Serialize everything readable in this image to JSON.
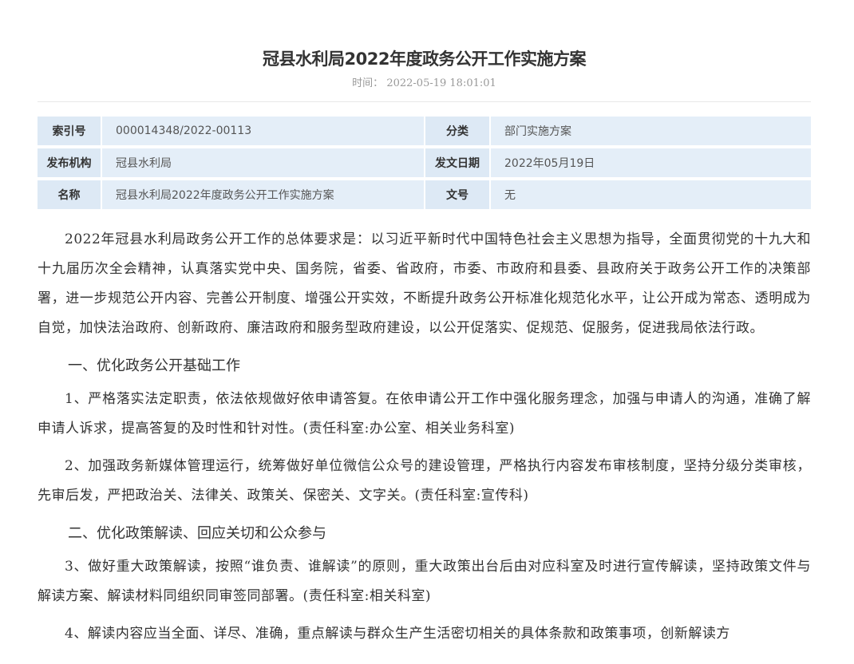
{
  "article": {
    "title": "冠县水利局2022年度政务公开工作实施方案",
    "time_label": "时间：",
    "time_value": "2022-05-19 18:01:01"
  },
  "meta": {
    "index_label": "索引号",
    "index_value": "000014348/2022-00113",
    "category_label": "分类",
    "category_value": "部门实施方案",
    "publisher_label": "发布机构",
    "publisher_value": "冠县水利局",
    "date_label": "发文日期",
    "date_value": "2022年05月19日",
    "name_label": "名称",
    "name_value": "冠县水利局2022年度政务公开工作实施方案",
    "docno_label": "文号",
    "docno_value": "无"
  },
  "content": {
    "intro": "2022年冠县水利局政务公开工作的总体要求是：以习近平新时代中国特色社会主义思想为指导，全面贯彻党的十九大和十九届历次全会精神，认真落实党中央、国务院，省委、省政府，市委、市政府和县委、县政府关于政务公开工作的决策部署，进一步规范公开内容、完善公开制度、增强公开实效，不断提升政务公开标准化规范化水平，让公开成为常态、透明成为自觉，加快法治政府、创新政府、廉洁政府和服务型政府建设，以公开促落实、促规范、促服务，促进我局依法行政。",
    "heading1": "一、优化政务公开基础工作",
    "item1": "1、严格落实法定职责，依法依规做好依申请答复。在依申请公开工作中强化服务理念，加强与申请人的沟通，准确了解申请人诉求，提高答复的及时性和针对性。(责任科室:办公室、相关业务科室)",
    "item2": "2、加强政务新媒体管理运行，统筹做好单位微信公众号的建设管理，严格执行内容发布审核制度，坚持分级分类审核，先审后发，严把政治关、法律关、政策关、保密关、文字关。(责任科室:宣传科)",
    "heading2": "二、优化政策解读、回应关切和公众参与",
    "item3": "3、做好重大政策解读，按照“谁负责、谁解读”的原则，重大政策出台后由对应科室及时进行宣传解读，坚持政策文件与解读方案、解读材料同组织同审签同部署。(责任科室:相关科室)",
    "item4": "4、解读内容应当全面、详尽、准确，重点解读与群众生产生活密切相关的具体条款和政策事项，创新解读方"
  }
}
